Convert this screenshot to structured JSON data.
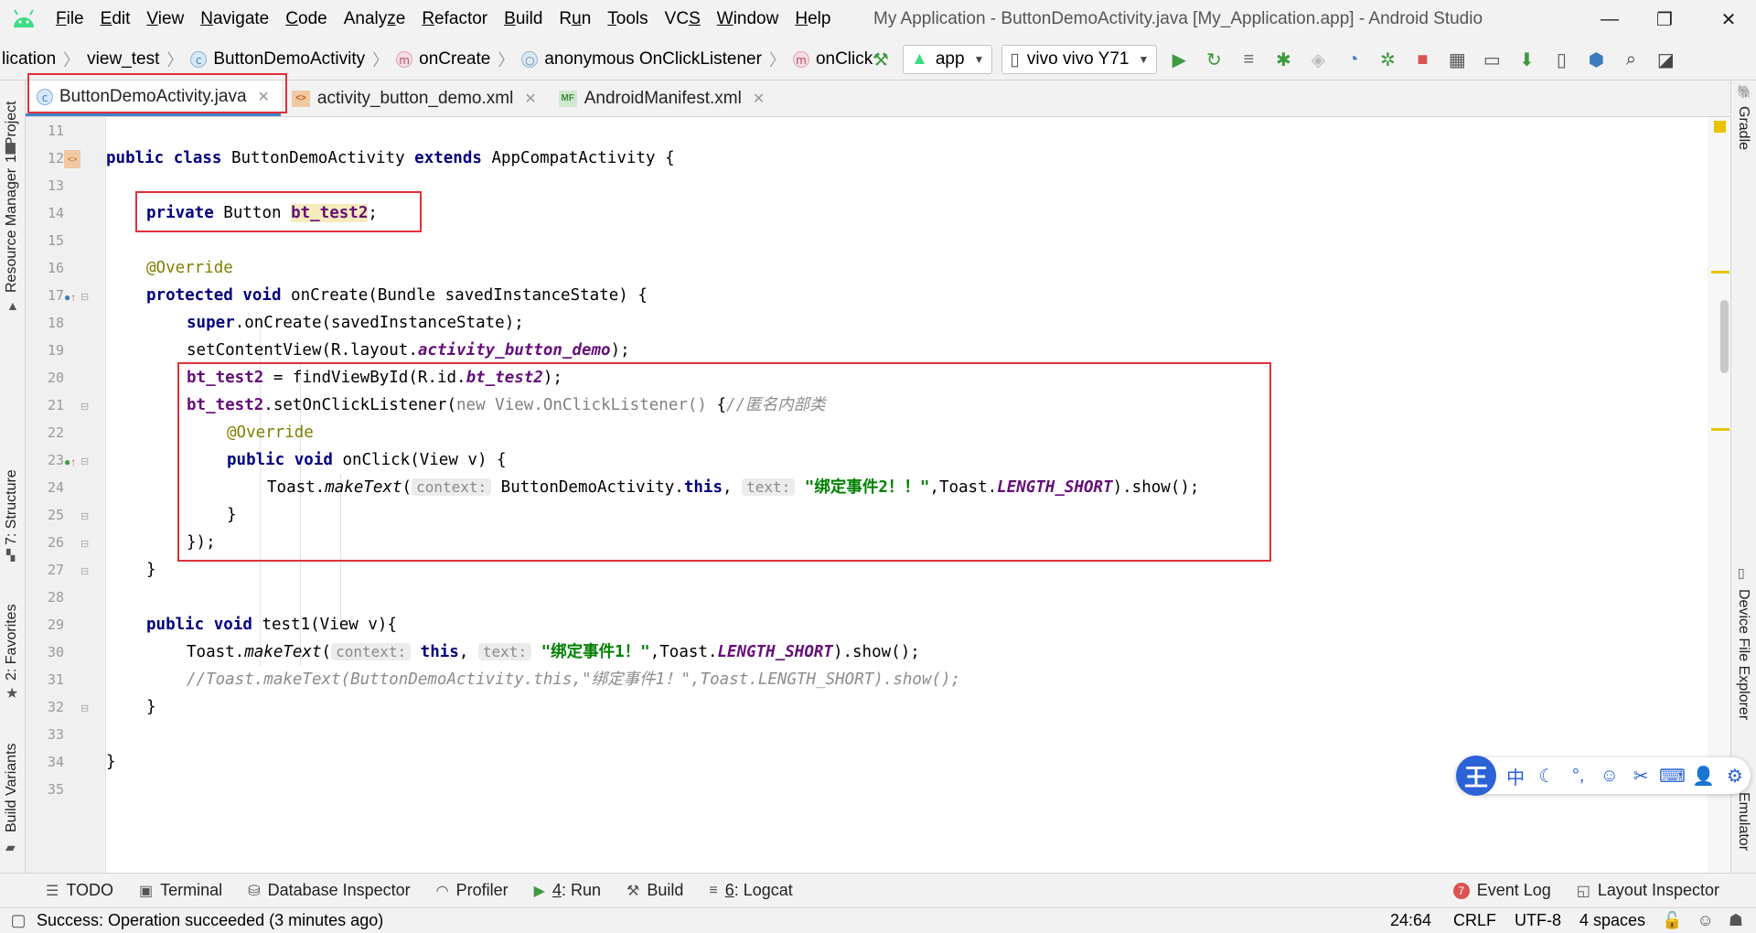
{
  "menubar": {
    "items": [
      {
        "mn": "F",
        "rest": "ile"
      },
      {
        "mn": "E",
        "rest": "dit"
      },
      {
        "mn": "V",
        "rest": "iew"
      },
      {
        "mn": "N",
        "rest": "avigate"
      },
      {
        "mn": "C",
        "rest": "ode"
      },
      {
        "pre": "Analy",
        "mn": "z",
        "rest": "e"
      },
      {
        "mn": "R",
        "rest": "efactor"
      },
      {
        "mn": "B",
        "rest": "uild"
      },
      {
        "pre": "R",
        "mn": "u",
        "rest": "n"
      },
      {
        "mn": "T",
        "rest": "ools"
      },
      {
        "pre": "VC",
        "mn": "S",
        "rest": ""
      },
      {
        "mn": "W",
        "rest": "indow"
      },
      {
        "mn": "H",
        "rest": "elp"
      }
    ],
    "window_title": "My Application - ButtonDemoActivity.java [My_Application.app] - Android Studio",
    "minimize": "—",
    "maximize": "❐",
    "close": "✕"
  },
  "navbar": {
    "crumbs": [
      "lication",
      "view_test",
      "ButtonDemoActivity",
      "onCreate",
      "anonymous OnClickListener",
      "onClick"
    ],
    "run_config": "app",
    "device": "vivo vivo Y71",
    "icons": [
      "hammer-icon",
      "run-icon",
      "apply-changes-icon",
      "apply-code-changes-icon",
      "debug-icon",
      "attach-debugger-icon",
      "profile-icon",
      "attach-profiler-icon",
      "stop-icon",
      "project-structure-icon",
      "avd-manager-icon",
      "sdk-manager-icon",
      "device-manager-icon",
      "sync-icon",
      "search-icon",
      "theme-icon"
    ]
  },
  "tabs": [
    {
      "label": "ButtonDemoActivity.java",
      "type": "c-icon",
      "active": true
    },
    {
      "label": "activity_button_demo.xml",
      "type": "layout-icon",
      "active": false
    },
    {
      "label": "AndroidManifest.xml",
      "type": "manifest-icon",
      "active": false
    }
  ],
  "left_tool_windows": [
    "1: Project",
    "Resource Manager",
    "7: Structure",
    "2: Favorites",
    "Build Variants"
  ],
  "right_tool_windows": [
    "Gradle",
    "Device File Explorer",
    "Emulator"
  ],
  "editor": {
    "line_numbers": [
      "11",
      "12",
      "13",
      "14",
      "15",
      "16",
      "17",
      "18",
      "19",
      "20",
      "21",
      "22",
      "23",
      "24",
      "25",
      "26",
      "27",
      "28",
      "29",
      "30",
      "31",
      "32",
      "33",
      "34",
      "35"
    ],
    "code": {
      "l12_kw1": "public class ",
      "l12_name": "ButtonDemoActivity ",
      "l12_kw2": "extends ",
      "l12_rest": "AppCompatActivity {",
      "l14_kw": "private ",
      "l14_type": "Button ",
      "l14_field": "bt_test2",
      "l14_end": ";",
      "l16": "@Override",
      "l17_kw": "protected void ",
      "l17_rest": "onCreate(Bundle savedInstanceState) {",
      "l18_kw": "super",
      "l18_rest": ".onCreate(savedInstanceState);",
      "l19_a": "setContentView(R.layout.",
      "l19_b": "activity_button_demo",
      "l19_c": ");",
      "l20_a": "bt_test2",
      "l20_b": " = findViewById(R.id.",
      "l20_c": "bt_test2",
      "l20_d": ");",
      "l21_a": "bt_test2",
      "l21_b": ".setOnClickListener(",
      "l21_c": "new ",
      "l21_d": "View.OnClickListener() ",
      "l21_e": "{",
      "l21_f": "//匿名内部类",
      "l22": "@Override",
      "l23_kw": "public void ",
      "l23_rest": "onClick(View v) {",
      "l24_a": "Toast.",
      "l24_b": "makeText",
      "l24_c": "(",
      "l24_hint1": "context:",
      "l24_d": " ButtonDemoActivity.",
      "l24_e": "this",
      "l24_f": ", ",
      "l24_hint2": "text:",
      "l24_g": " \"绑定事件2！！\"",
      "l24_h": ",Toast.",
      "l24_i": "LENGTH_SHORT",
      "l24_j": ").show();",
      "l25": "}",
      "l26": "});",
      "l27": "}",
      "l29_kw": "public void ",
      "l29_rest": "test1(View v){",
      "l30_a": "Toast.",
      "l30_b": "makeText",
      "l30_c": "(",
      "l30_hint1": "context:",
      "l30_d": " ",
      "l30_e": "this",
      "l30_f": ", ",
      "l30_hint2": "text:",
      "l30_g": " \"绑定事件1！\"",
      "l30_h": ",Toast.",
      "l30_i": "LENGTH_SHORT",
      "l30_j": ").show();",
      "l31": "//Toast.makeText(ButtonDemoActivity.this,\"绑定事件1！\",Toast.LENGTH_SHORT).show();",
      "l32": "}",
      "l34": "}"
    }
  },
  "bottom_tools": {
    "left": [
      {
        "label": "TODO",
        "icon": "todo-icon"
      },
      {
        "label": "Terminal",
        "icon": "terminal-icon"
      },
      {
        "label": "Database Inspector",
        "icon": "database-icon"
      },
      {
        "label": "Profiler",
        "icon": "profiler-icon"
      },
      {
        "mn": "4",
        "label": ": Run",
        "icon": "run-icon"
      },
      {
        "label": "Build",
        "icon": "build-icon"
      },
      {
        "mn": "6",
        "label": ": Logcat",
        "icon": "logcat-icon"
      }
    ],
    "event_log": "Event Log",
    "event_log_count": "7",
    "layout_inspector": "Layout Inspector"
  },
  "status": {
    "message": "Success: Operation succeeded (3 minutes ago)",
    "position": "24:64",
    "line_sep": "CRLF",
    "encoding": "UTF-8",
    "indent": "4 spaces"
  },
  "ime": {
    "logo": "王",
    "items": [
      "中",
      "☾",
      "°,",
      "☺",
      "✂",
      "⌨",
      "👤",
      "⚙"
    ]
  },
  "colors": {
    "accent": "#4083c9",
    "highlight_box": "#e0303a",
    "string": "#008000",
    "keyword": "#000080",
    "field": "#660e7a"
  }
}
